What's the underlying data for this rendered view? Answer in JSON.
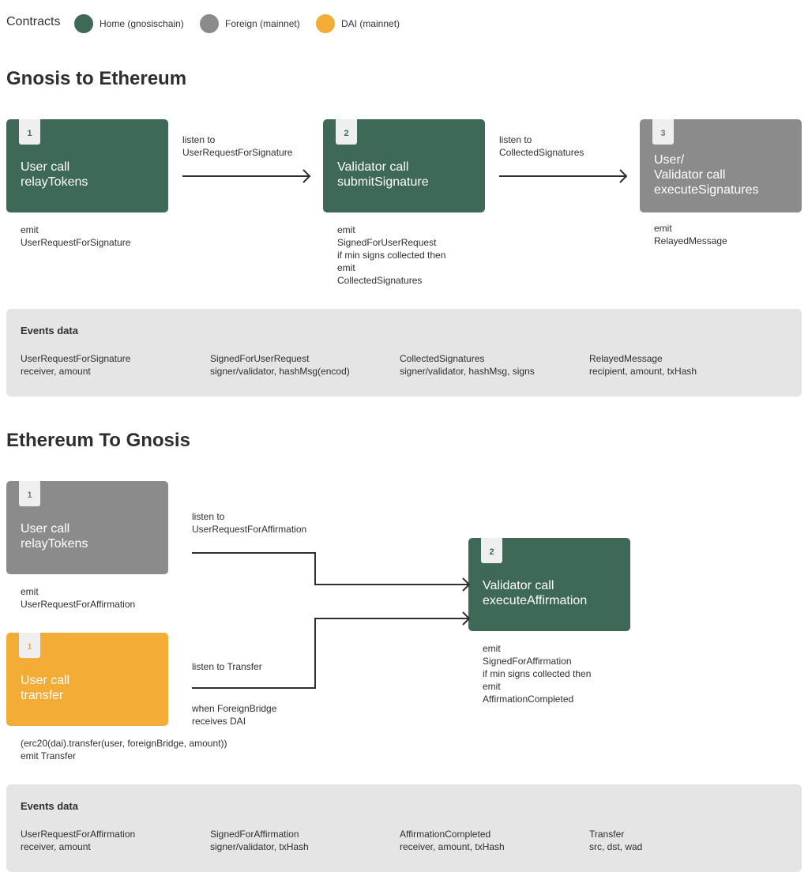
{
  "legend": {
    "title": "Contracts",
    "items": [
      {
        "label": "Home (gnosischain)",
        "color": "#3e6956"
      },
      {
        "label": "Foreign (mainnet)",
        "color": "#8b8b8b"
      },
      {
        "label": "DAI (mainnet)",
        "color": "#f3ac35"
      }
    ]
  },
  "colors": {
    "home": "#3e6956",
    "foreign": "#8b8b8b",
    "dai": "#f3ac35",
    "panel": "#e5e5e5"
  },
  "g2e": {
    "title": "Gnosis to Ethereum",
    "steps": [
      {
        "num": "1",
        "title": "User call\nrelayTokens",
        "note": "emit\nUserRequestForSignature"
      },
      {
        "num": "2",
        "title": "Validator call\nsubmitSignature",
        "note": "emit\nSignedForUserRequest\nif min signs collected then\nemit\nCollectedSignatures"
      },
      {
        "num": "3",
        "title": "User/\nValidator call\nexecuteSignatures",
        "note": "emit\nRelayedMessage"
      }
    ],
    "arrows": [
      {
        "label": "listen to\nUserRequestForSignature"
      },
      {
        "label": "listen to\nCollectedSignatures"
      }
    ],
    "events": {
      "title": "Events data",
      "items": [
        {
          "name": "UserRequestForSignature",
          "fields": "receiver, amount"
        },
        {
          "name": "SignedForUserRequest",
          "fields": "signer/validator, hashMsg(encod)"
        },
        {
          "name": "CollectedSignatures",
          "fields": "signer/validator, hashMsg, signs"
        },
        {
          "name": "RelayedMessage",
          "fields": "recipient, amount, txHash"
        }
      ]
    }
  },
  "e2g": {
    "title": "Ethereum To Gnosis",
    "steps": [
      {
        "num": "1",
        "title": "User call\nrelayTokens",
        "note": "emit\nUserRequestForAffirmation"
      },
      {
        "num": "1",
        "title": "User call\ntransfer",
        "note": "(erc20(dai).transfer(user, foreignBridge, amount))\nemit Transfer"
      },
      {
        "num": "2",
        "title": "Validator call\nexecuteAffirmation",
        "note": "emit\nSignedForAffirmation\nif min signs collected then\nemit\nAffirmationCompleted"
      }
    ],
    "arrows": [
      {
        "label": "listen to\nUserRequestForAffirmation"
      },
      {
        "label": "listen to Transfer",
        "sublabel": "when ForeignBridge\nreceives DAI"
      }
    ],
    "events": {
      "title": "Events data",
      "items": [
        {
          "name": "UserRequestForAffirmation",
          "fields": "receiver, amount"
        },
        {
          "name": "SignedForAffirmation",
          "fields": "signer/validator, txHash"
        },
        {
          "name": "AffirmationCompleted",
          "fields": "receiver, amount, txHash"
        },
        {
          "name": "Transfer",
          "fields": "src, dst, wad"
        }
      ]
    }
  }
}
